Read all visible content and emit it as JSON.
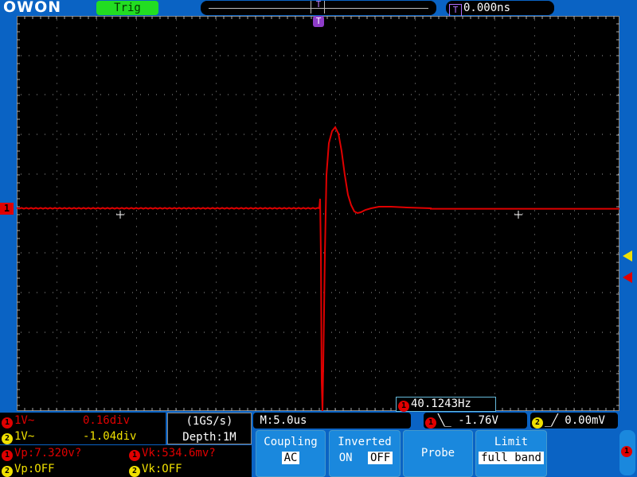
{
  "header": {
    "logo": "OWON",
    "trig_status": "Trig",
    "time_offset": "0.000ns",
    "trigger_marker": "T"
  },
  "channel_marker": "1",
  "freq_readout": {
    "channel": "1",
    "value": "40.1243Hz"
  },
  "channels": [
    {
      "id": "1",
      "scale": "1V~",
      "offset": "0.16div",
      "color": "#e00000"
    },
    {
      "id": "2",
      "scale": "1V~",
      "offset": "-1.04div",
      "color": "#f0e000"
    }
  ],
  "acq": {
    "rate": "(1GS/s)",
    "depth": "Depth:1M"
  },
  "measurements": [
    {
      "channel": "1",
      "label": "Vp:7.320v?"
    },
    {
      "channel": "1",
      "label": "Vk:534.6mv?"
    },
    {
      "channel": "2",
      "label": "Vp:OFF"
    },
    {
      "channel": "2",
      "label": "Vk:OFF"
    }
  ],
  "timebase": "M:5.0us",
  "trigger": {
    "ch1_channel": "1",
    "ch1_level": "-1.76V",
    "ch2_channel": "2",
    "ch2_level": "0.00mV"
  },
  "menu": {
    "coupling": {
      "title": "Coupling",
      "value": "AC"
    },
    "inverted": {
      "title": "Inverted",
      "on": "ON",
      "off": "OFF"
    },
    "probe": {
      "title": "Probe"
    },
    "limit": {
      "title": "Limit",
      "value": "full band"
    }
  },
  "scroll_channel": "1",
  "colors": {
    "background": "#0a63c4",
    "trace": "#e00000",
    "ch2": "#f0e000",
    "trig_badge": "#22dd22"
  }
}
